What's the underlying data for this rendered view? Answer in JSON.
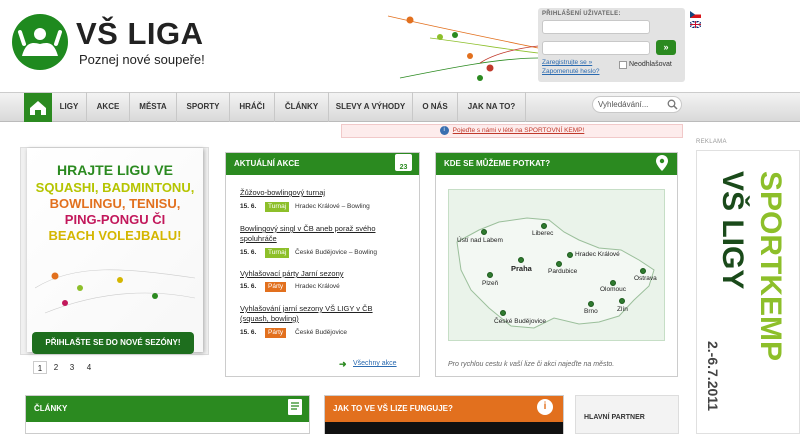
{
  "header": {
    "logo_title": "VŠ LIGA",
    "logo_subtitle": "Poznej nové soupeře!",
    "login": {
      "label": "PŘIHLÁŠENÍ UŽIVATELE:",
      "go": "»",
      "register": "Zaregistrujte se »",
      "forgot": "Zapomenuté heslo?",
      "remember": "Neodhlašovat"
    }
  },
  "nav": {
    "items": [
      "LIGY",
      "AKCE",
      "MĚSTA",
      "SPORTY",
      "HRÁČI",
      "ČLÁNKY",
      "SLEVY A VÝHODY",
      "O NÁS",
      "JAK NA TO?"
    ],
    "search_placeholder": "Vyhledávání..."
  },
  "promo_text": "Pojeďte s námi v létě na SPORTOVNÍ KEMP!",
  "banner": {
    "lines": [
      "HRAJTE LIGU VE",
      "SQUASHI, BADMINTONU,",
      "BOWLINGU, TENISU,",
      "PING-PONGU ČI",
      "BEACH VOLEJBALU!"
    ],
    "cta": "PŘIHLAŠTE SE DO NOVÉ SEZÓNY!",
    "pages": [
      "1",
      "2",
      "3",
      "4"
    ]
  },
  "events": {
    "title": "AKTUÁLNÍ AKCE",
    "calendar_day": "23",
    "items": [
      {
        "title": "Žůžovo-bowlingový turnaj",
        "date": "15. 6.",
        "tag": "Turnaj",
        "location": "Hradec Králové – Bowling"
      },
      {
        "title": "Bowlingový singl v ČB aneb poraž svého",
        "title2": "spoluhráče",
        "date": "15. 6.",
        "tag": "Turnaj",
        "location": "České Budějovice – Bowling"
      },
      {
        "title": "Vyhlašovací párty Jarní sezony",
        "date": "15. 6.",
        "tag": "Párty",
        "location": "Hradec Králové"
      },
      {
        "title": "Vyhlašování jarní sezony VŠ LIGY v ČB",
        "title2": "(squash, bowling)",
        "date": "15. 6.",
        "tag": "Párty",
        "location": "České Budějovice"
      }
    ],
    "all_link": "Všechny akce"
  },
  "map": {
    "title": "KDE SE MŮŽEME POTKAT?",
    "cities": [
      "Ústí nad Labem",
      "Liberec",
      "Praha",
      "Hradec Králové",
      "Pardubice",
      "Plzeň",
      "Olomouc",
      "Ostrava",
      "Brno",
      "Zlín",
      "České Budějovice"
    ],
    "caption": "Pro rychlou cestu k vaší lize či akci najeďte na město."
  },
  "bottom": {
    "articles": "ČLÁNKY",
    "how": "JAK TO VE VŠ LIZE FUNGUJE?",
    "partner": "HLAVNÍ PARTNER"
  },
  "ad": {
    "label": "REKLAMA",
    "line1": "SPORTKEMP",
    "line2": "VŠ LIGY",
    "dates": "2.-6.7.2011"
  },
  "colors": {
    "brand_green": "#2b8a20",
    "tag_green": "#8dbf2a",
    "tag_orange": "#e2701e",
    "how_orange": "#e2701e"
  }
}
